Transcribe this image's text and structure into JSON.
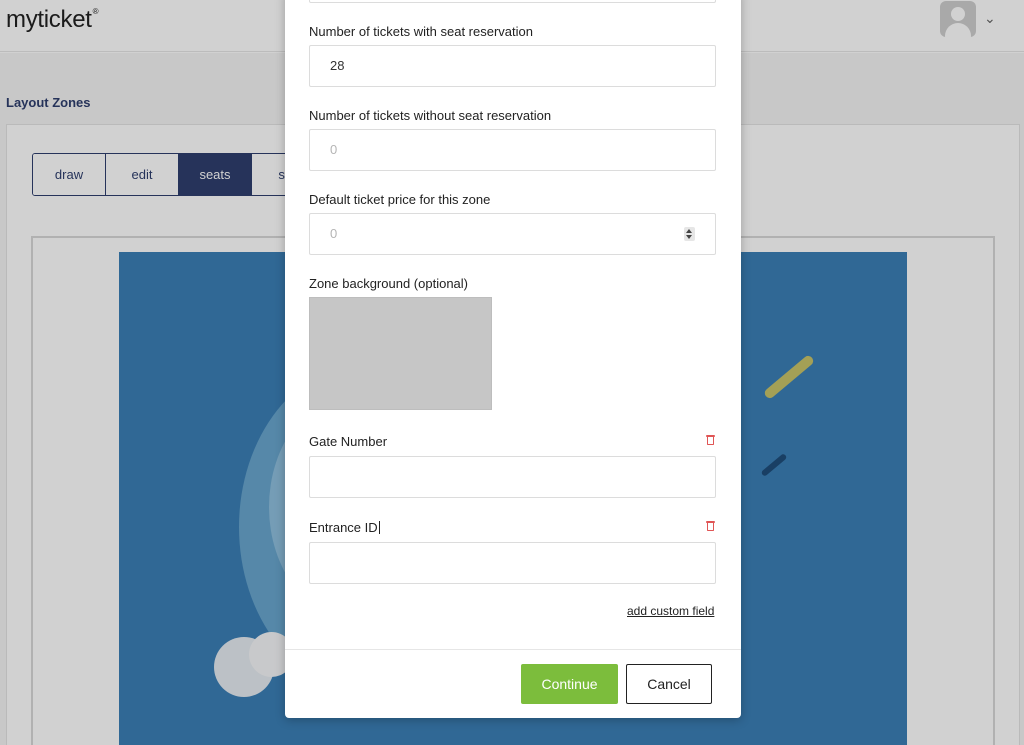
{
  "app": {
    "logo_text": "myticket",
    "logo_mark": "®",
    "section_title": "Layout Zones",
    "tabs": [
      {
        "label": "draw"
      },
      {
        "label": "edit"
      },
      {
        "label": "seats",
        "active": true
      },
      {
        "label": "sav"
      }
    ],
    "user_icon": "user-avatar-icon",
    "menu_icon": "chevron-down-icon"
  },
  "modal": {
    "fields": {
      "seat_tickets": {
        "label": "Number of tickets with seat reservation",
        "value": "28"
      },
      "no_seat_tickets": {
        "label": "Number of tickets without seat reservation",
        "placeholder": "0"
      },
      "default_price": {
        "label": "Default ticket price for this zone",
        "placeholder": "0"
      },
      "zone_background": {
        "label": "Zone background (optional)"
      },
      "gate_number": {
        "label": "Gate Number",
        "value": ""
      },
      "entrance_id": {
        "label": "Entrance ID",
        "value": ""
      }
    },
    "add_custom_field": "add custom field",
    "buttons": {
      "continue": "Continue",
      "cancel": "Cancel"
    }
  },
  "colors": {
    "primary": "#2f3f6e",
    "continue": "#7cbd3c",
    "delete": "#e05555",
    "map": "#3b7fb6"
  }
}
